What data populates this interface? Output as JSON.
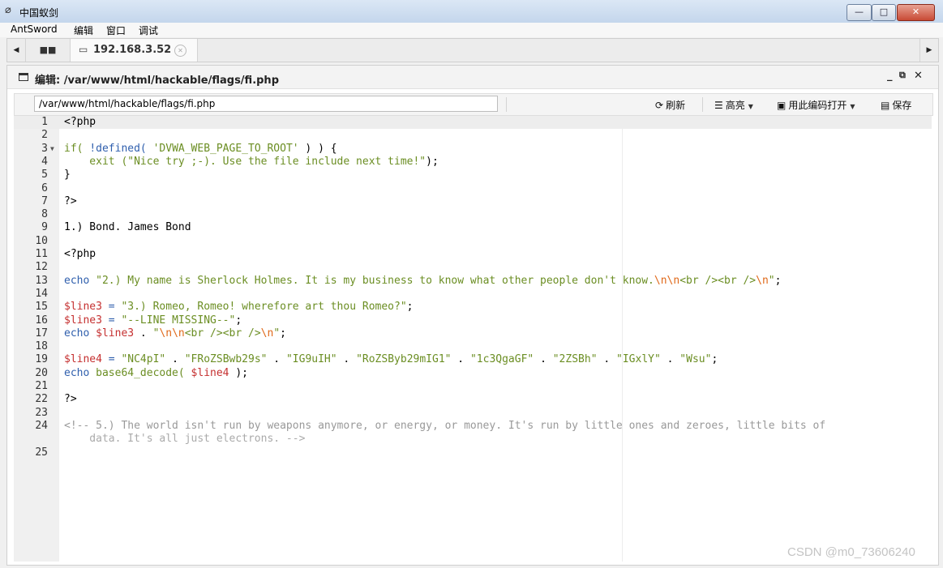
{
  "window": {
    "title": "中国蚁剑",
    "icon": "antsword-logo-icon",
    "controls": {
      "minimize": "—",
      "maximize": "□",
      "close": "✕"
    }
  },
  "menu": [
    "AntSword",
    "编辑",
    "窗口",
    "调试"
  ],
  "tabs": {
    "home_icon": "grid-icon",
    "active_label": "192.168.3.52"
  },
  "panel": {
    "title": "编辑: /var/www/html/hackable/flags/fi.php",
    "controls": [
      "_",
      "ᐧ",
      "✕"
    ]
  },
  "toolbar": {
    "path_value": "/var/www/html/hackable/flags/fi.php",
    "refresh_label": "刷新",
    "highlight_label": "高亮",
    "open_with_encoding_label": "用此编码打开",
    "save_label": "保存"
  },
  "editor": {
    "lines": [
      {
        "n": "1",
        "fold": false,
        "code": [
          {
            "t": "<?php",
            "c": "c-text"
          }
        ]
      },
      {
        "n": "2",
        "fold": false,
        "code": []
      },
      {
        "n": "3",
        "fold": true,
        "code": [
          {
            "t": "if( ",
            "c": "c-green"
          },
          {
            "t": "!defined( ",
            "c": "c-fn"
          },
          {
            "t": "'DVWA_WEB_PAGE_TO_ROOT'",
            "c": "c-green"
          },
          {
            "t": " ) ) {",
            "c": "c-text"
          }
        ]
      },
      {
        "n": "4",
        "fold": false,
        "code": [
          {
            "t": "    exit (",
            "c": "c-green"
          },
          {
            "t": "\"Nice try ;-). Use the file include next time!\"",
            "c": "c-green"
          },
          {
            "t": ");",
            "c": "c-text"
          }
        ]
      },
      {
        "n": "5",
        "fold": false,
        "code": [
          {
            "t": "}",
            "c": "c-text"
          }
        ]
      },
      {
        "n": "6",
        "fold": false,
        "code": []
      },
      {
        "n": "7",
        "fold": false,
        "code": [
          {
            "t": "?>",
            "c": "c-text"
          }
        ]
      },
      {
        "n": "8",
        "fold": false,
        "code": []
      },
      {
        "n": "9",
        "fold": false,
        "code": [
          {
            "t": "1.) Bond. James Bond",
            "c": "c-text"
          }
        ]
      },
      {
        "n": "10",
        "fold": false,
        "code": []
      },
      {
        "n": "11",
        "fold": false,
        "code": [
          {
            "t": "<?php",
            "c": "c-text"
          }
        ]
      },
      {
        "n": "12",
        "fold": false,
        "code": []
      },
      {
        "n": "13",
        "fold": false,
        "code": [
          {
            "t": "echo ",
            "c": "c-fn"
          },
          {
            "t": "\"2.) My name is Sherlock Holmes. It is my business to know what other people don't know.",
            "c": "c-green"
          },
          {
            "t": "\\n\\n",
            "c": "c-esc"
          },
          {
            "t": "<br /><br />",
            "c": "c-green"
          },
          {
            "t": "\\n",
            "c": "c-esc"
          },
          {
            "t": "\"",
            "c": "c-green"
          },
          {
            "t": ";",
            "c": "c-text"
          }
        ]
      },
      {
        "n": "14",
        "fold": false,
        "code": []
      },
      {
        "n": "15",
        "fold": false,
        "code": [
          {
            "t": "$line3",
            "c": "c-var"
          },
          {
            "t": " = ",
            "c": "c-fn"
          },
          {
            "t": "\"3.) Romeo, Romeo! wherefore art thou Romeo?\"",
            "c": "c-green"
          },
          {
            "t": ";",
            "c": "c-text"
          }
        ]
      },
      {
        "n": "16",
        "fold": false,
        "code": [
          {
            "t": "$line3",
            "c": "c-var"
          },
          {
            "t": " = ",
            "c": "c-fn"
          },
          {
            "t": "\"--LINE MISSING--\"",
            "c": "c-green"
          },
          {
            "t": ";",
            "c": "c-text"
          }
        ]
      },
      {
        "n": "17",
        "fold": false,
        "code": [
          {
            "t": "echo ",
            "c": "c-fn"
          },
          {
            "t": "$line3",
            "c": "c-var"
          },
          {
            "t": " . ",
            "c": "c-text"
          },
          {
            "t": "\"",
            "c": "c-green"
          },
          {
            "t": "\\n\\n",
            "c": "c-esc"
          },
          {
            "t": "<br /><br />",
            "c": "c-green"
          },
          {
            "t": "\\n",
            "c": "c-esc"
          },
          {
            "t": "\"",
            "c": "c-green"
          },
          {
            "t": ";",
            "c": "c-text"
          }
        ]
      },
      {
        "n": "18",
        "fold": false,
        "code": []
      },
      {
        "n": "19",
        "fold": false,
        "code": [
          {
            "t": "$line4",
            "c": "c-var"
          },
          {
            "t": " = ",
            "c": "c-fn"
          },
          {
            "t": "\"NC4pI\"",
            "c": "c-green"
          },
          {
            "t": " . ",
            "c": "c-text"
          },
          {
            "t": "\"FRoZSBwb29s\"",
            "c": "c-green"
          },
          {
            "t": " . ",
            "c": "c-text"
          },
          {
            "t": "\"IG9uIH\"",
            "c": "c-green"
          },
          {
            "t": " . ",
            "c": "c-text"
          },
          {
            "t": "\"RoZSByb29mIG1\"",
            "c": "c-green"
          },
          {
            "t": " . ",
            "c": "c-text"
          },
          {
            "t": "\"1c3QgaGF\"",
            "c": "c-green"
          },
          {
            "t": " . ",
            "c": "c-text"
          },
          {
            "t": "\"2ZSBh\"",
            "c": "c-green"
          },
          {
            "t": " . ",
            "c": "c-text"
          },
          {
            "t": "\"IGxlY\"",
            "c": "c-green"
          },
          {
            "t": " . ",
            "c": "c-text"
          },
          {
            "t": "\"Wsu\"",
            "c": "c-green"
          },
          {
            "t": ";",
            "c": "c-text"
          }
        ]
      },
      {
        "n": "20",
        "fold": false,
        "code": [
          {
            "t": "echo ",
            "c": "c-fn"
          },
          {
            "t": "base64_decode( ",
            "c": "c-green"
          },
          {
            "t": "$line4",
            "c": "c-var"
          },
          {
            "t": " );",
            "c": "c-text"
          }
        ]
      },
      {
        "n": "21",
        "fold": false,
        "code": []
      },
      {
        "n": "22",
        "fold": false,
        "code": [
          {
            "t": "?>",
            "c": "c-text"
          }
        ]
      },
      {
        "n": "23",
        "fold": false,
        "code": []
      },
      {
        "n": "24",
        "fold": false,
        "code": [
          {
            "t": "<!-- 5.) The world isn't run by weapons anymore, or energy, or money. It's run by little ones and zeroes, little bits of",
            "c": "c-comment"
          }
        ],
        "wrap": "    data. It's all just electrons. -->"
      },
      {
        "n": "25",
        "fold": false,
        "code": []
      }
    ]
  },
  "watermark": "CSDN @m0_73606240"
}
